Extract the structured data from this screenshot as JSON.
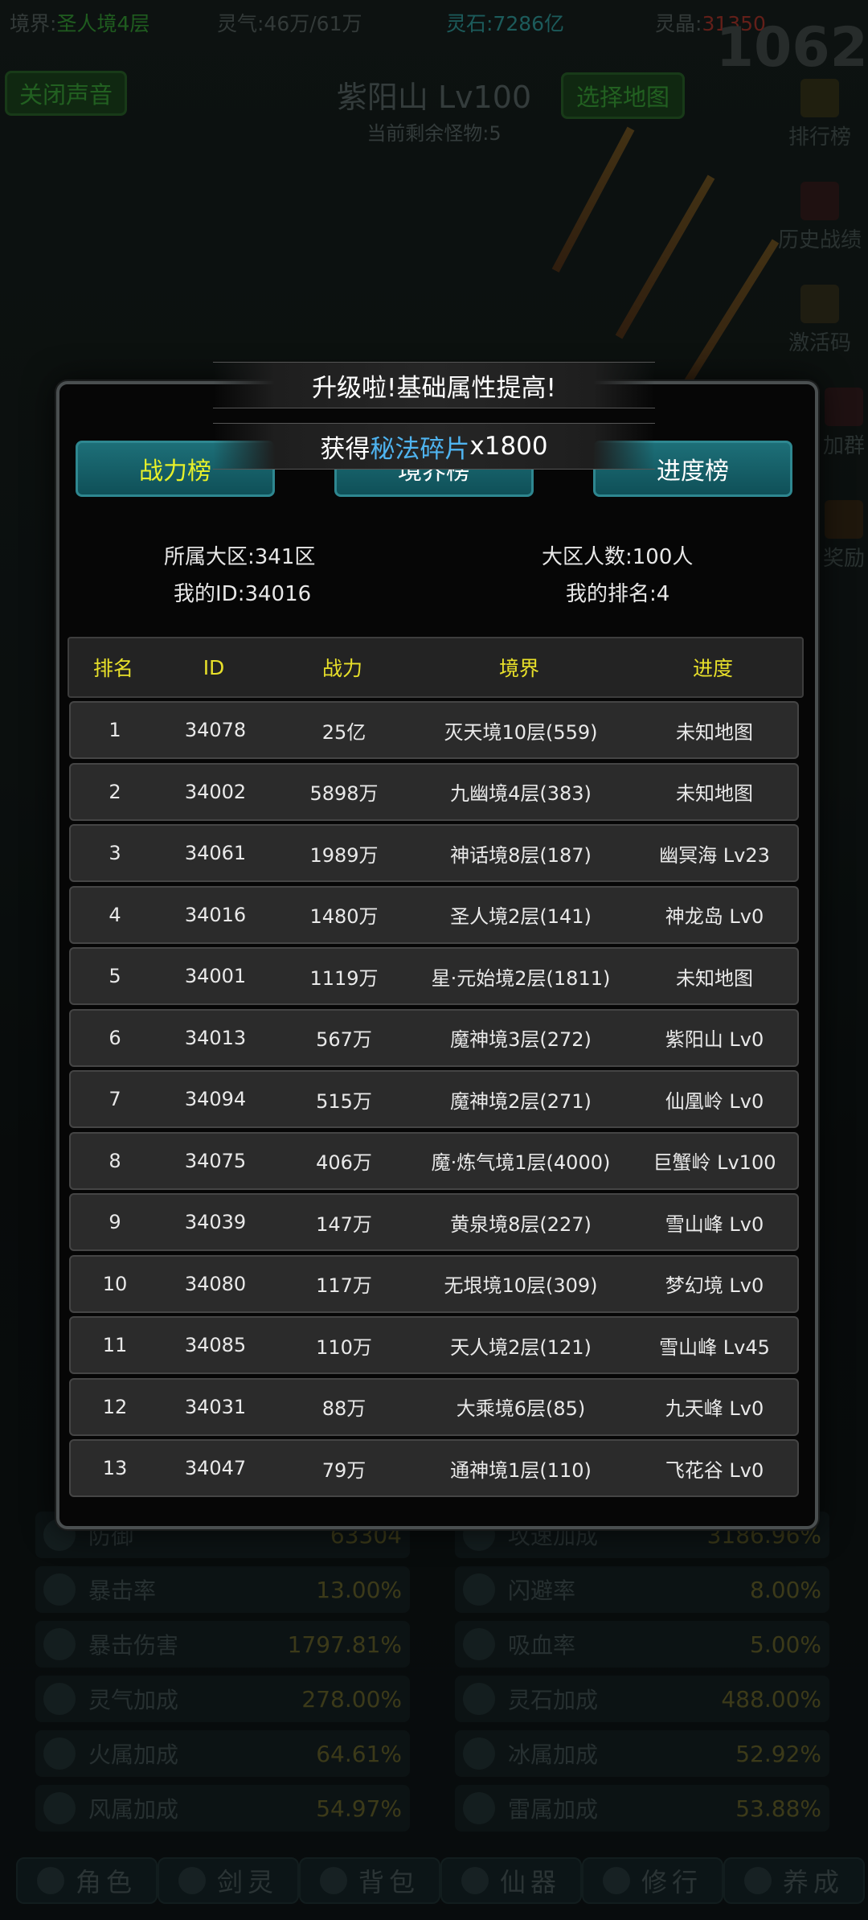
{
  "status_bar": {
    "realm_label": "境界:",
    "realm_value": "圣人境4层",
    "qi": "灵气:46万/61万",
    "stones": "灵石:7286亿",
    "crystals_label": "灵晶:",
    "crystals_value": "31350"
  },
  "bg_digits": "1062",
  "sound_button": "关闭声音",
  "select_map_button": "选择地图",
  "map": {
    "title": "紫阳山 Lv100",
    "remaining": "当前剩余怪物:5"
  },
  "side_menu": [
    "排行榜",
    "历史战绩",
    "激活码",
    "加群",
    "奖励"
  ],
  "background_stats": [
    {
      "label": "防御",
      "value": "63304",
      "icon": "shield-icon"
    },
    {
      "label": "攻速加成",
      "value": "3186.96%",
      "icon": "speed-icon"
    },
    {
      "label": "暴击率",
      "value": "13.00%",
      "icon": "crit-icon"
    },
    {
      "label": "闪避率",
      "value": "8.00%",
      "icon": "boot-icon"
    },
    {
      "label": "暴击伤害",
      "value": "1797.81%",
      "icon": "crit-damage-icon"
    },
    {
      "label": "吸血率",
      "value": "5.00%",
      "icon": "sword-icon"
    },
    {
      "label": "灵气加成",
      "value": "278.00%",
      "icon": "spiral-icon"
    },
    {
      "label": "灵石加成",
      "value": "488.00%",
      "icon": "crystal-icon"
    },
    {
      "label": "火属加成",
      "value": "64.61%",
      "icon": "fire-icon"
    },
    {
      "label": "冰属加成",
      "value": "52.92%",
      "icon": "ice-icon"
    },
    {
      "label": "风属加成",
      "value": "54.97%",
      "icon": "wind-icon"
    },
    {
      "label": "雷属加成",
      "value": "53.88%",
      "icon": "thunder-icon"
    }
  ],
  "bottom_nav": [
    "角色",
    "剑灵",
    "背包",
    "仙器",
    "修行",
    "养成"
  ],
  "toasts": {
    "upgrade": "升级啦!基础属性提高!",
    "reward_prefix": "获得 ",
    "reward_item": "秘法碎片",
    "reward_suffix": "x1800"
  },
  "leaderboard": {
    "tabs": [
      "战力榜",
      "境界榜",
      "进度榜"
    ],
    "active_tab": 0,
    "region": "所属大区:341区",
    "population": "大区人数:100人",
    "my_id": "我的ID:34016",
    "my_rank": "我的排名:4",
    "columns": [
      "排名",
      "ID",
      "战力",
      "境界",
      "进度"
    ],
    "rows": [
      [
        "1",
        "34078",
        "25亿",
        "灭天境10层(559)",
        "未知地图"
      ],
      [
        "2",
        "34002",
        "5898万",
        "九幽境4层(383)",
        "未知地图"
      ],
      [
        "3",
        "34061",
        "1989万",
        "神话境8层(187)",
        "幽冥海 Lv23"
      ],
      [
        "4",
        "34016",
        "1480万",
        "圣人境2层(141)",
        "神龙岛 Lv0"
      ],
      [
        "5",
        "34001",
        "1119万",
        "星·元始境2层(1811)",
        "未知地图"
      ],
      [
        "6",
        "34013",
        "567万",
        "魔神境3层(272)",
        "紫阳山 Lv0"
      ],
      [
        "7",
        "34094",
        "515万",
        "魔神境2层(271)",
        "仙凰岭 Lv0"
      ],
      [
        "8",
        "34075",
        "406万",
        "魔·炼气境1层(4000)",
        "巨蟹岭 Lv100"
      ],
      [
        "9",
        "34039",
        "147万",
        "黄泉境8层(227)",
        "雪山峰 Lv0"
      ],
      [
        "10",
        "34080",
        "117万",
        "无垠境10层(309)",
        "梦幻境 Lv0"
      ],
      [
        "11",
        "34085",
        "110万",
        "天人境2层(121)",
        "雪山峰 Lv45"
      ],
      [
        "12",
        "34031",
        "88万",
        "大乘境6层(85)",
        "九天峰 Lv0"
      ],
      [
        "13",
        "34047",
        "79万",
        "通神境1层(110)",
        "飞花谷 Lv0"
      ]
    ]
  },
  "colors": {
    "tab_bg": "#0f5058",
    "active_tab_text": "#e6f02a",
    "header_text": "#e8e02a",
    "highlight": "#4fb4f0"
  }
}
